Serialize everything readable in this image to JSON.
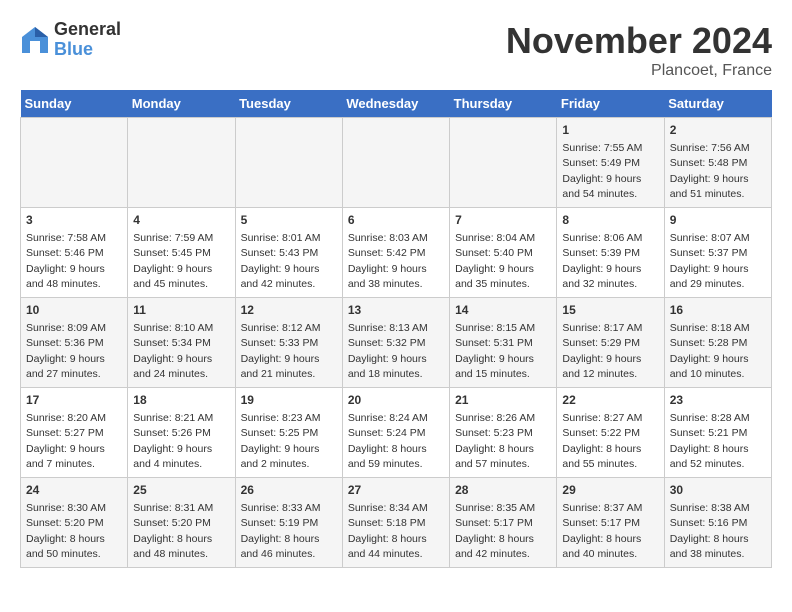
{
  "logo": {
    "general": "General",
    "blue": "Blue"
  },
  "title": "November 2024",
  "location": "Plancoet, France",
  "days_header": [
    "Sunday",
    "Monday",
    "Tuesday",
    "Wednesday",
    "Thursday",
    "Friday",
    "Saturday"
  ],
  "weeks": [
    {
      "cells": [
        {
          "day": "",
          "info": ""
        },
        {
          "day": "",
          "info": ""
        },
        {
          "day": "",
          "info": ""
        },
        {
          "day": "",
          "info": ""
        },
        {
          "day": "",
          "info": ""
        },
        {
          "day": "1",
          "info": "Sunrise: 7:55 AM\nSunset: 5:49 PM\nDaylight: 9 hours\nand 54 minutes."
        },
        {
          "day": "2",
          "info": "Sunrise: 7:56 AM\nSunset: 5:48 PM\nDaylight: 9 hours\nand 51 minutes."
        }
      ]
    },
    {
      "cells": [
        {
          "day": "3",
          "info": "Sunrise: 7:58 AM\nSunset: 5:46 PM\nDaylight: 9 hours\nand 48 minutes."
        },
        {
          "day": "4",
          "info": "Sunrise: 7:59 AM\nSunset: 5:45 PM\nDaylight: 9 hours\nand 45 minutes."
        },
        {
          "day": "5",
          "info": "Sunrise: 8:01 AM\nSunset: 5:43 PM\nDaylight: 9 hours\nand 42 minutes."
        },
        {
          "day": "6",
          "info": "Sunrise: 8:03 AM\nSunset: 5:42 PM\nDaylight: 9 hours\nand 38 minutes."
        },
        {
          "day": "7",
          "info": "Sunrise: 8:04 AM\nSunset: 5:40 PM\nDaylight: 9 hours\nand 35 minutes."
        },
        {
          "day": "8",
          "info": "Sunrise: 8:06 AM\nSunset: 5:39 PM\nDaylight: 9 hours\nand 32 minutes."
        },
        {
          "day": "9",
          "info": "Sunrise: 8:07 AM\nSunset: 5:37 PM\nDaylight: 9 hours\nand 29 minutes."
        }
      ]
    },
    {
      "cells": [
        {
          "day": "10",
          "info": "Sunrise: 8:09 AM\nSunset: 5:36 PM\nDaylight: 9 hours\nand 27 minutes."
        },
        {
          "day": "11",
          "info": "Sunrise: 8:10 AM\nSunset: 5:34 PM\nDaylight: 9 hours\nand 24 minutes."
        },
        {
          "day": "12",
          "info": "Sunrise: 8:12 AM\nSunset: 5:33 PM\nDaylight: 9 hours\nand 21 minutes."
        },
        {
          "day": "13",
          "info": "Sunrise: 8:13 AM\nSunset: 5:32 PM\nDaylight: 9 hours\nand 18 minutes."
        },
        {
          "day": "14",
          "info": "Sunrise: 8:15 AM\nSunset: 5:31 PM\nDaylight: 9 hours\nand 15 minutes."
        },
        {
          "day": "15",
          "info": "Sunrise: 8:17 AM\nSunset: 5:29 PM\nDaylight: 9 hours\nand 12 minutes."
        },
        {
          "day": "16",
          "info": "Sunrise: 8:18 AM\nSunset: 5:28 PM\nDaylight: 9 hours\nand 10 minutes."
        }
      ]
    },
    {
      "cells": [
        {
          "day": "17",
          "info": "Sunrise: 8:20 AM\nSunset: 5:27 PM\nDaylight: 9 hours\nand 7 minutes."
        },
        {
          "day": "18",
          "info": "Sunrise: 8:21 AM\nSunset: 5:26 PM\nDaylight: 9 hours\nand 4 minutes."
        },
        {
          "day": "19",
          "info": "Sunrise: 8:23 AM\nSunset: 5:25 PM\nDaylight: 9 hours\nand 2 minutes."
        },
        {
          "day": "20",
          "info": "Sunrise: 8:24 AM\nSunset: 5:24 PM\nDaylight: 8 hours\nand 59 minutes."
        },
        {
          "day": "21",
          "info": "Sunrise: 8:26 AM\nSunset: 5:23 PM\nDaylight: 8 hours\nand 57 minutes."
        },
        {
          "day": "22",
          "info": "Sunrise: 8:27 AM\nSunset: 5:22 PM\nDaylight: 8 hours\nand 55 minutes."
        },
        {
          "day": "23",
          "info": "Sunrise: 8:28 AM\nSunset: 5:21 PM\nDaylight: 8 hours\nand 52 minutes."
        }
      ]
    },
    {
      "cells": [
        {
          "day": "24",
          "info": "Sunrise: 8:30 AM\nSunset: 5:20 PM\nDaylight: 8 hours\nand 50 minutes."
        },
        {
          "day": "25",
          "info": "Sunrise: 8:31 AM\nSunset: 5:20 PM\nDaylight: 8 hours\nand 48 minutes."
        },
        {
          "day": "26",
          "info": "Sunrise: 8:33 AM\nSunset: 5:19 PM\nDaylight: 8 hours\nand 46 minutes."
        },
        {
          "day": "27",
          "info": "Sunrise: 8:34 AM\nSunset: 5:18 PM\nDaylight: 8 hours\nand 44 minutes."
        },
        {
          "day": "28",
          "info": "Sunrise: 8:35 AM\nSunset: 5:17 PM\nDaylight: 8 hours\nand 42 minutes."
        },
        {
          "day": "29",
          "info": "Sunrise: 8:37 AM\nSunset: 5:17 PM\nDaylight: 8 hours\nand 40 minutes."
        },
        {
          "day": "30",
          "info": "Sunrise: 8:38 AM\nSunset: 5:16 PM\nDaylight: 8 hours\nand 38 minutes."
        }
      ]
    }
  ]
}
